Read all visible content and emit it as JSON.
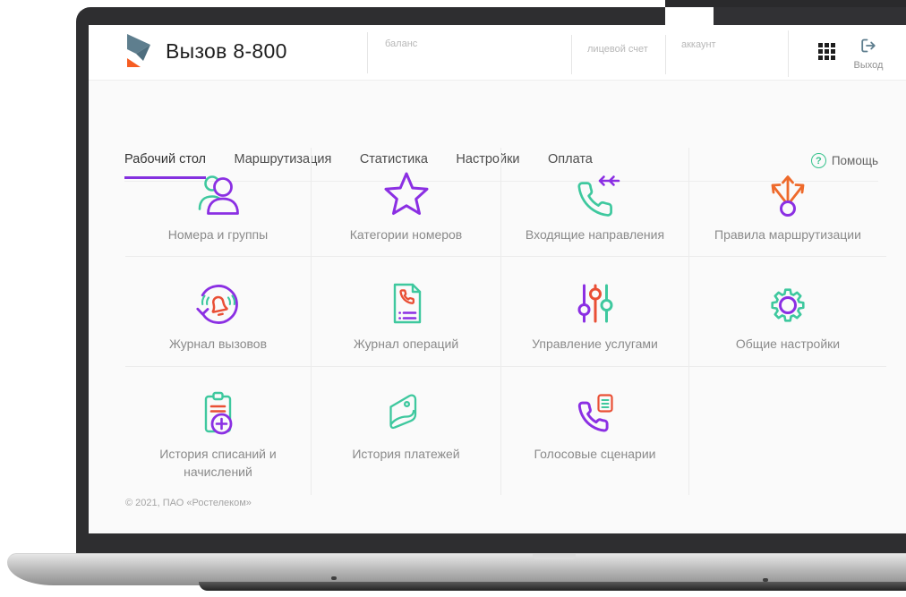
{
  "header": {
    "brand": "Вызов 8-800",
    "fields": [
      {
        "label": "баланс"
      },
      {
        "label": "лицевой счет"
      },
      {
        "label": "аккаунт"
      }
    ],
    "logout_label": "Выход"
  },
  "nav": {
    "tabs": [
      {
        "label": "Рабочий стол",
        "active": true
      },
      {
        "label": "Маршрутизация",
        "active": false
      },
      {
        "label": "Статистика",
        "active": false
      },
      {
        "label": "Настройки",
        "active": false
      },
      {
        "label": "Оплата",
        "active": false
      }
    ],
    "help": {
      "label": "Помощь",
      "icon_glyph": "?"
    }
  },
  "tiles": [
    {
      "label": "Номера и группы",
      "icon": "users-icon"
    },
    {
      "label": "Категории номеров",
      "icon": "star-icon"
    },
    {
      "label": "Входящие направления",
      "icon": "incoming-call-icon"
    },
    {
      "label": "Правила маршрутизации",
      "icon": "routing-icon"
    },
    {
      "label": "Журнал вызовов",
      "icon": "call-log-icon"
    },
    {
      "label": "Журнал операций",
      "icon": "operations-log-icon"
    },
    {
      "label": "Управление услугами",
      "icon": "sliders-icon"
    },
    {
      "label": "Общие настройки",
      "icon": "gear-icon"
    },
    {
      "label": "История списаний и начислений",
      "icon": "charges-history-icon"
    },
    {
      "label": "История платежей",
      "icon": "wallet-icon"
    },
    {
      "label": "Голосовые сценарии",
      "icon": "voice-scripts-icon"
    }
  ],
  "footer": {
    "copyright": "© 2021, ПАО «Ростелеком»"
  },
  "colors": {
    "accent_purple": "#8B2FE3",
    "teal": "#3EC89E",
    "orange": "#EE6A2B",
    "red_orange": "#E94F35",
    "help_green": "#35C28C",
    "tab_underline": "#8430DF"
  }
}
